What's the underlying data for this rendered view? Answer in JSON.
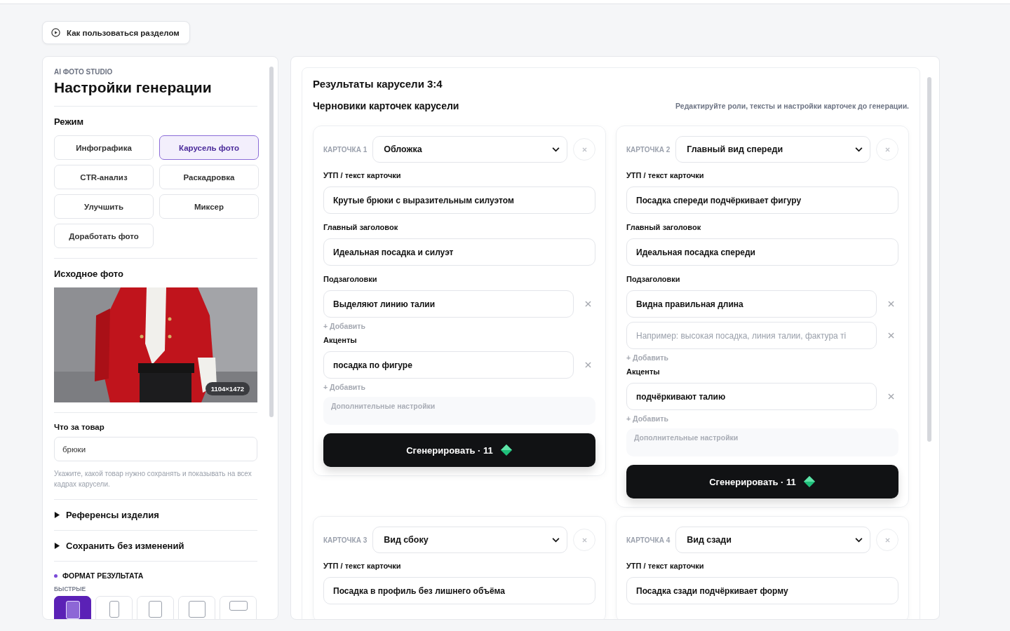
{
  "help_button": {
    "label": "Как пользоваться разделом"
  },
  "settings": {
    "brand": "AI ФОТО STUDIO",
    "title": "Настройки генерации",
    "mode_heading": "Режим",
    "modes": [
      {
        "label": "Инфографика",
        "selected": false
      },
      {
        "label": "Карусель фото",
        "selected": true
      },
      {
        "label": "CTR-анализ",
        "selected": false
      },
      {
        "label": "Раскадровка",
        "selected": false
      },
      {
        "label": "Улучшить",
        "selected": false
      },
      {
        "label": "Миксер",
        "selected": false
      },
      {
        "label": "Доработать фото",
        "selected": false
      }
    ],
    "source_heading": "Исходное фото",
    "photo": {
      "kind": "picture",
      "size_badge": "1104×1472"
    },
    "product": {
      "label": "Что за товар",
      "value": "брюки",
      "hint": "Укажите, какой товар нужно сохранять и показывать на всех кадрах карусели."
    },
    "sections": [
      {
        "label": "Референсы изделия",
        "expanded": false
      },
      {
        "label": "Сохранить без изменений",
        "expanded": false
      }
    ],
    "format": {
      "heading": "ФОРМАТ РЕЗУЛЬТАТА",
      "group": "БЫСТРЫЕ",
      "presets": [
        {
          "kind": "portrait",
          "selected": true
        },
        {
          "kind": "tall",
          "selected": false
        },
        {
          "kind": "upright",
          "selected": false
        },
        {
          "kind": "square",
          "selected": false
        },
        {
          "kind": "wide",
          "selected": false
        }
      ]
    }
  },
  "results": {
    "title": "Результаты карусели 3:4",
    "subtitle": "Черновики карточек карусели",
    "note": "Редактируйте роли, тексты и настройки карточек до генерации.",
    "cards": [
      {
        "number": "КАРТОЧКА 1",
        "role": "Обложка",
        "sections": [
          {
            "kind": "field",
            "label": "УТП / текст карточки",
            "value": "Крутые брюки с выразительным силуэтом"
          },
          {
            "kind": "field",
            "label": "Главный заголовок",
            "value": "Идеальная посадка и силуэт"
          },
          {
            "kind": "list",
            "label": "Подзаголовки",
            "items": [
              {
                "value": "Выделяют линию талии"
              }
            ],
            "add": "+ Добавить"
          },
          {
            "kind": "list",
            "label": "Акценты",
            "items": [
              {
                "value": "посадка по фигуре"
              }
            ],
            "add": "+ Добавить"
          },
          {
            "kind": "more",
            "label": "Дополнительные настройки"
          }
        ],
        "generate": "Сгенерировать · 11"
      },
      {
        "number": "КАРТОЧКА 2",
        "role": "Главный вид спереди",
        "sections": [
          {
            "kind": "field",
            "label": "УТП / текст карточки",
            "value": "Посадка спереди подчёркивает фигуру"
          },
          {
            "kind": "field",
            "label": "Главный заголовок",
            "value": "Идеальная посадка спереди"
          },
          {
            "kind": "list",
            "label": "Подзаголовки",
            "items": [
              {
                "value": "Видна правильная длина"
              },
              {
                "placeholder": "Например: высокая посадка, линия талии, фактура ті"
              }
            ],
            "add": "+ Добавить"
          },
          {
            "kind": "list",
            "label": "Акценты",
            "items": [
              {
                "value": "подчёркивают талию"
              }
            ],
            "add": "+ Добавить"
          },
          {
            "kind": "more",
            "label": "Дополнительные настройки"
          }
        ],
        "generate": "Сгенерировать · 11"
      },
      {
        "number": "КАРТОЧКА 3",
        "role": "Вид сбоку",
        "sections": [
          {
            "kind": "field",
            "label": "УТП / текст карточки",
            "value": "Посадка в профиль без лишнего объёма"
          }
        ]
      },
      {
        "number": "КАРТОЧКА 4",
        "role": "Вид сзади",
        "sections": [
          {
            "kind": "field",
            "label": "УТП / текст карточки",
            "value": "Посадка сзади подчёркивает форму"
          }
        ]
      }
    ]
  }
}
